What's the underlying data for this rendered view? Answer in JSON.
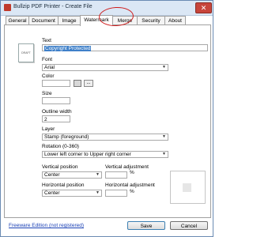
{
  "window": {
    "title": "Bullzip PDF Printer - Create File",
    "close_glyph": "✕"
  },
  "tabs": [
    {
      "label": "General"
    },
    {
      "label": "Document"
    },
    {
      "label": "Image"
    },
    {
      "label": "Watermark"
    },
    {
      "label": "Merge"
    },
    {
      "label": "Security"
    },
    {
      "label": "About"
    }
  ],
  "active_tab": "Watermark",
  "doc_icon_label": "DRAFT",
  "form": {
    "text_label": "Text",
    "text_value": "Copyright Protected",
    "font_label": "Font",
    "font_value": "Arial",
    "color_label": "Color",
    "color_value": "",
    "color_button": "...",
    "size_label": "Size",
    "size_value": "",
    "outline_label": "Outline width",
    "outline_value": "2",
    "layer_label": "Layer",
    "layer_value": "Stamp (foreground)",
    "rotation_label": "Rotation (0-360)",
    "rotation_value": "Lower left corner to Upper right corner",
    "vpos_label": "Vertical position",
    "vpos_value": "Center",
    "vadj_label": "Vertical adjustment",
    "vadj_unit": "%",
    "hpos_label": "Horizontal position",
    "hpos_value": "Center",
    "hadj_label": "Horizontal adjustment",
    "hadj_unit": "%"
  },
  "footer": {
    "link": "Freeware Edition (not registered)",
    "save": "Save",
    "cancel": "Cancel"
  },
  "dropdown_arrow": "▼"
}
